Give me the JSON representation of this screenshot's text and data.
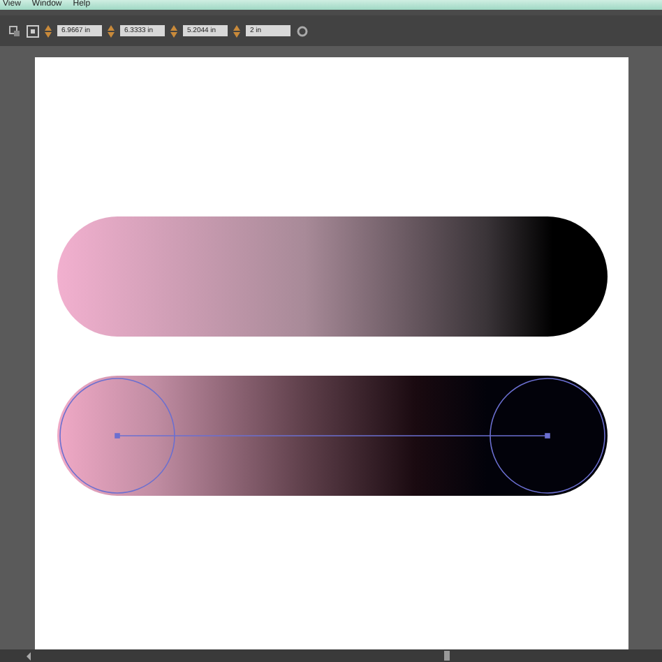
{
  "menu": [
    "View",
    "Window",
    "Help"
  ],
  "toolbar": {
    "fields": [
      {
        "value": "6.9667 in"
      },
      {
        "value": "6.3333 in"
      },
      {
        "value": "5.2044 in"
      },
      {
        "value": "2 in"
      }
    ]
  }
}
